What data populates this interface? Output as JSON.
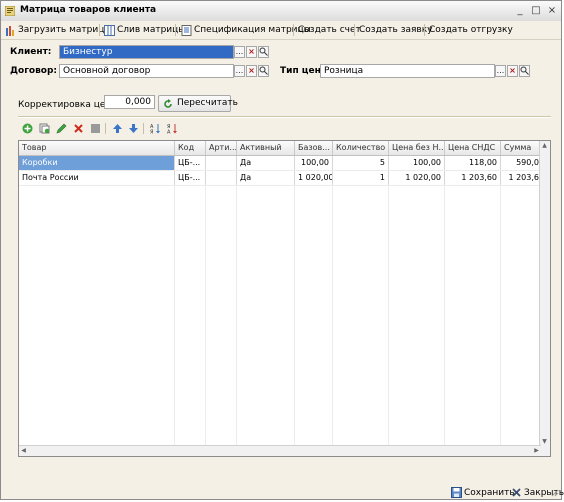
{
  "window": {
    "title": "Матрица товаров клиента",
    "controls": [
      "_",
      "□",
      "×"
    ]
  },
  "toolbar": {
    "items": [
      "Загрузить матрицу",
      "Слив матрицы",
      "Спецификация матрицы",
      "Создать счет",
      "Создать заявку",
      "Создать отгрузку"
    ]
  },
  "form": {
    "client_label": "Клиент:",
    "client_value": "Бизнестур",
    "contract_label": "Договор:",
    "contract_value": "Основной договор",
    "price_type_label": "Тип цен:",
    "price_type_value": "Розница",
    "field_buttons": [
      "...",
      "×",
      "Q"
    ],
    "price_adjust_label": "Корректировка цены:",
    "price_adjust_value": "0,000",
    "recalc_button": "Пересчитать"
  },
  "table": {
    "columns": [
      "Товар",
      "Код",
      "Арти...",
      "Активный",
      "Базов...",
      "Количество",
      "Цена без Н...",
      "Цена СНДС",
      "Сумма"
    ],
    "rows": [
      [
        "Коробки",
        "ЦБ-...",
        "",
        "Да",
        "100,00",
        "5",
        "100,00",
        "118,00",
        "590,0"
      ],
      [
        "Почта России",
        "ЦБ-...",
        "",
        "Да",
        "1 020,00",
        "1",
        "1 020,00",
        "1 203,60",
        "1 203,6"
      ]
    ]
  },
  "footer": {
    "save_label": "Сохранить",
    "close_label": "Закрыть"
  },
  "colors": {
    "selection": "#316ac5",
    "selected_cell": "#6f9fd8",
    "window_bg": "#f4f0e6"
  }
}
